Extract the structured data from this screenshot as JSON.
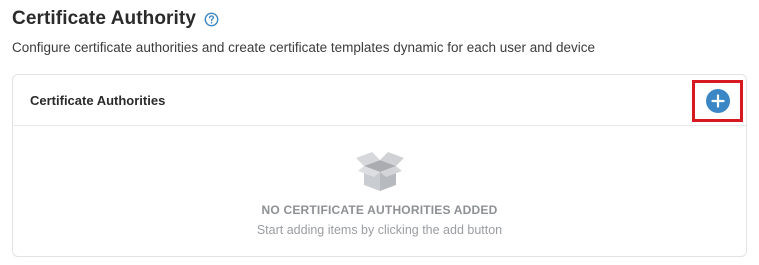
{
  "page": {
    "title": "Certificate Authority",
    "help_icon": "question-circle-icon",
    "subtitle": "Configure certificate authorities and create certificate templates dynamic for each user and device"
  },
  "card": {
    "title": "Certificate Authorities",
    "add_icon": "plus-icon",
    "empty_icon": "open-box-icon",
    "empty_title": "NO CERTIFICATE AUTHORITIES ADDED",
    "empty_hint": "Start adding items by clicking the add button"
  },
  "colors": {
    "accent": "#3b86c4",
    "highlight": "#d71921",
    "muted_text": "#8d9095"
  }
}
